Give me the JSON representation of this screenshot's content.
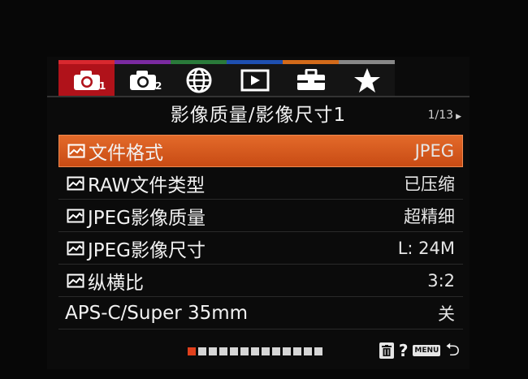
{
  "tabs": [
    {
      "name": "camera-1",
      "icon": "camera-icon",
      "num": "1",
      "active": true
    },
    {
      "name": "camera-2",
      "icon": "camera-icon",
      "num": "2",
      "active": false
    },
    {
      "name": "network",
      "icon": "globe-icon",
      "num": "",
      "active": false
    },
    {
      "name": "playback",
      "icon": "play-icon",
      "num": "",
      "active": false
    },
    {
      "name": "setup",
      "icon": "toolbox-icon",
      "num": "",
      "active": false
    },
    {
      "name": "favorite",
      "icon": "star-icon",
      "num": "",
      "active": false
    }
  ],
  "tab_colors": [
    "#d8282f",
    "#7a2aa0",
    "#2a7a3a",
    "#1e4fb0",
    "#d26a1a",
    "#888888"
  ],
  "title": "影像质量/影像尺寸1",
  "page_indicator": "1/13",
  "menu": [
    {
      "label": "文件格式",
      "value": "JPEG",
      "icon": "still-image-icon",
      "selected": true
    },
    {
      "label": "RAW文件类型",
      "value": "已压缩",
      "icon": "still-image-icon",
      "selected": false
    },
    {
      "label": "JPEG影像质量",
      "value": "超精细",
      "icon": "still-image-icon",
      "selected": false
    },
    {
      "label": "JPEG影像尺寸",
      "value": "L: 24M",
      "icon": "still-image-icon",
      "selected": false
    },
    {
      "label": "纵横比",
      "value": "3:2",
      "icon": "still-image-icon",
      "selected": false
    },
    {
      "label": "APS-C/Super 35mm",
      "value": "关",
      "icon": "",
      "selected": false
    }
  ],
  "page_dots": {
    "total": 13,
    "current": 1
  },
  "footer": {
    "help": "?",
    "menu_badge": "MENU"
  }
}
